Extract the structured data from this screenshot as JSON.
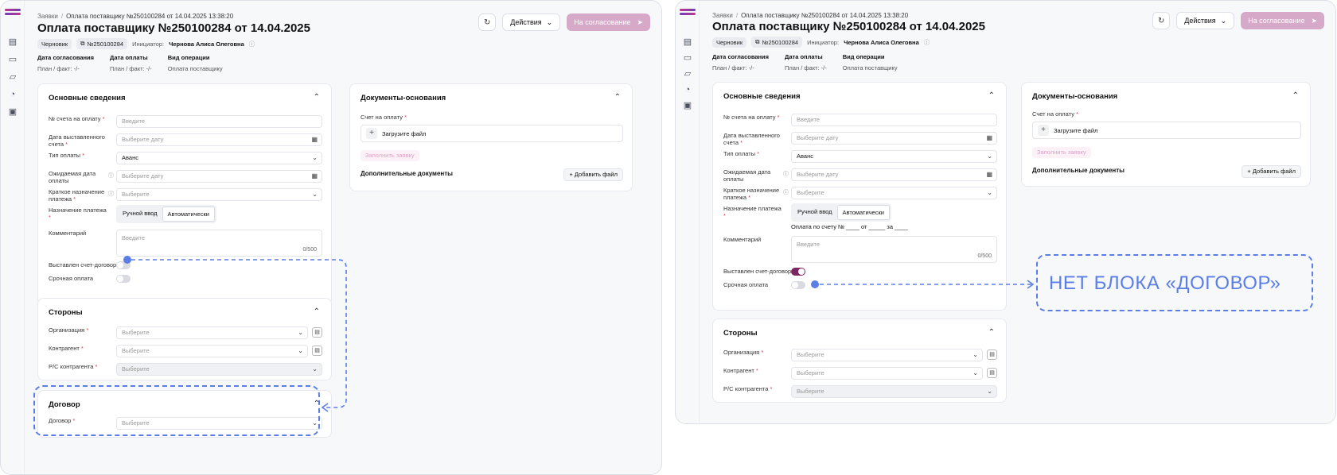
{
  "colors": {
    "accent": "#5b7ee6",
    "primary_disabled": "#d7a9c9",
    "toggle_on": "#7a2660",
    "required": "#e03a4e"
  },
  "breadcrumb": {
    "root": "Заявки",
    "sep": "/",
    "current": "Оплата поставщику №250100284 от 14.04.2025 13:38:20"
  },
  "page_title": "Оплата поставщику №250100284 от 14.04.2025",
  "meta": {
    "status": "Черновик",
    "number": "№250100284",
    "initiator_label": "Инициатор:",
    "initiator_value": "Чернова Алиса Олеговна"
  },
  "toolbar": {
    "history_icon": "history-icon",
    "actions_label": "Действия",
    "submit_label": "На согласование"
  },
  "info": {
    "approval_date_label": "Дата согласования",
    "approval_date_value": "План / факт: -/-",
    "payment_date_label": "Дата оплаты",
    "payment_date_value": "План / факт: -/-",
    "operation_label": "Вид операции",
    "operation_value": "Оплата поставщику"
  },
  "main_section": {
    "title": "Основные сведения",
    "invoice_no_label": "№ счета на оплату",
    "invoice_no_placeholder": "Введите",
    "invoice_date_label": "Дата выставленного счета",
    "invoice_date_placeholder": "Выберите дату",
    "payment_type_label": "Тип оплаты",
    "payment_type_value": "Аванс",
    "expected_date_label": "Ожидаемая дата оплаты",
    "expected_date_placeholder": "Выберите дату",
    "short_purpose_label": "Краткое назначение платежа",
    "short_purpose_placeholder": "Выберите",
    "purpose_label": "Назначение платежа",
    "purpose_manual": "Ручной ввод",
    "purpose_auto": "Автоматически",
    "purpose_template": "Оплата по счету № ____ от _____ за ____",
    "comment_label": "Комментарий",
    "comment_placeholder": "Введите",
    "comment_counter": "0/500",
    "invoice_contract_label": "Выставлен счет-договор",
    "urgent_label": "Срочная оплата"
  },
  "parties": {
    "title": "Стороны",
    "org_label": "Организация",
    "org_placeholder": "Выберите",
    "counterparty_label": "Контрагент",
    "counterparty_placeholder": "Выберите",
    "account_label": "Р/С контрагента",
    "account_placeholder": "Выберите"
  },
  "contract": {
    "title": "Договор",
    "label": "Договор",
    "placeholder": "Выберите"
  },
  "docs": {
    "title": "Документы-основания",
    "invoice_label": "Счет на оплату",
    "upload_label": "Загрузите файл",
    "fill_button": "Заполнить заявку",
    "additional_title": "Дополнительные документы",
    "add_file_button": "Добавить файл"
  },
  "annotation": {
    "text": "НЕТ БЛОКА «ДОГОВОР»"
  }
}
